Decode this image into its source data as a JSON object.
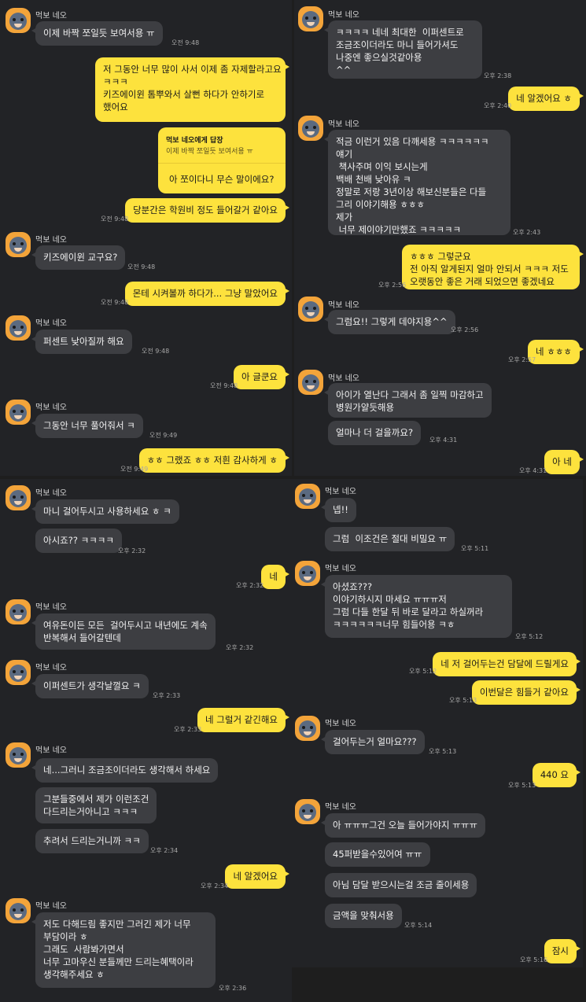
{
  "contact_name": "먹보 네오",
  "panels": {
    "p1": [
      {
        "name": "먹보 네오"
      },
      {
        "text": "이제 바짝 쪼일듯 보여서용 ㅠ",
        "time": "오전 9:48"
      },
      {
        "text": "저 그동안 너무 많이 사서 이제 좀 자제할라고요\nㅋㅋㅋ\n키즈에이윈 톰뿌와서 살뻔 하다가 안하기로\n했어요"
      },
      {
        "reply_title": "먹보 네오에게 답장",
        "reply_quote": "이제 바짝 쪼일듯 보여서용 ㅠ",
        "reply_text": "아 쪼이다니 무슨 말이에요?"
      },
      {
        "text": "당분간은 학원비 정도 들어갈거 같아요",
        "time": "오전 9:48"
      },
      {
        "name": "먹보 네오"
      },
      {
        "text": "키즈에이윈 교구요?",
        "time": "오전 9:48"
      },
      {
        "text": "몬테 시켜볼까 하다가... 그냥 말았어요",
        "time": "오전 9:48"
      },
      {
        "name": "먹보 네오"
      },
      {
        "text": "퍼센트 낮아질까 해요",
        "time": "오전 9:48"
      },
      {
        "text": "아 글쿤요",
        "time": "오전 9:48"
      },
      {
        "name": "먹보 네오"
      },
      {
        "text": "그동안 너무 풀어줘서 ㅋ",
        "time": "오전 9:49"
      },
      {
        "text": "ㅎㅎ 그랬죠 ㅎㅎ 저흰 감사하게 ㅎ",
        "time": "오전 9:49"
      }
    ],
    "p2": [
      {
        "name": "먹보 네오"
      },
      {
        "text": "ㅋㅋㅋㅋ 네네 최대한  이퍼센트로\n조금조이더라도 마니 들어가셔도\n나중엔 좋으실것같아용\n^^",
        "time": "오후 2:38"
      },
      {
        "text": "네 알겠어요 ㅎ",
        "time": "오후 2:40"
      },
      {
        "name": "먹보 네오"
      },
      {
        "text": "적금 이런거 있음 다깨세용 ㅋㅋㅋㅋㅋㅋ\n얘기\n 책사주며 이익 보시는게\n백배 천배 낮아유 ㅋ\n정말로 저랑 3년이상 해보신분들은 다들\n그리 이야기해용 ㅎㅎㅎ\n제가\n 너무 제이야기만했죠 ㅋㅋㅋㅋㅋ",
        "time": "오후 2:43"
      },
      {
        "text": "ㅎㅎㅎ 그렇군요\n전 아직 알게된지 얼마 안되서 ㅋㅋㅋ 저도\n오랫동안 좋은 거래 되었으면 좋겠네요",
        "time": "오후 2:56"
      },
      {
        "name": "먹보 네오"
      },
      {
        "text": "그럼요!! 그렇게 데야지용^^",
        "time": "오후 2:56"
      },
      {
        "text": "네 ㅎㅎㅎ",
        "time": "오후 2:57"
      },
      {
        "name": "먹보 네오"
      },
      {
        "text": "아이가 열난다 그래서 좀 일찍 마감하고\n병원가얄듯해용"
      },
      {
        "text": "얼마나 더 걸을까요?",
        "time": "오후 4:31"
      },
      {
        "text": "아 네",
        "time": "오후 4:31"
      }
    ],
    "p3": [
      {
        "name": "먹보 네오"
      },
      {
        "text": "마니 걸어두시고 사용하세요 ㅎ ㅋ"
      },
      {
        "text": "아시죠?? ㅋㅋㅋㅋ",
        "time": "오후 2:32"
      },
      {
        "text": "네",
        "time": "오후 2:32"
      },
      {
        "name": "먹보 네오"
      },
      {
        "text": "여유돈이든 모든  걸어두시고 내년에도 계속\n반복해서 들어갈텐데",
        "time": "오후 2:32"
      },
      {
        "name": "먹보 네오"
      },
      {
        "text": "이퍼센트가 생각날껄요 ㅋ",
        "time": "오후 2:33"
      },
      {
        "text": "네 그럴거 같긴해요",
        "time": "오후 2:33"
      },
      {
        "name": "먹보 네오"
      },
      {
        "text": "네...그러니 조금조이더라도 생각해서 하세요"
      },
      {
        "text": "그분들중에서 제가 이런조건\n다드리는거아니고 ㅋㅋㅋ"
      },
      {
        "text": "추려서 드리는거니까 ㅋㅋ",
        "time": "오후 2:34"
      },
      {
        "text": "네 알겠어요",
        "time": "오후 2:34"
      },
      {
        "name": "먹보 네오"
      },
      {
        "text": "저도 다해드림 좋지만 그러긴 제가 너무\n부담이라 ㅎ\n그래도  사람봐가면서\n너무 고마우신 분들께만 드리는혜택이라\n생각해주세요 ㅎ",
        "time": "오후 2:36"
      }
    ],
    "p4": [
      {
        "name": "먹보 네오"
      },
      {
        "text": "넵!!"
      },
      {
        "text": "그럼  이조건은 절대 비밀요 ㅠ",
        "time": "오후 5:11"
      },
      {
        "name": "먹보 네오"
      },
      {
        "text": "아셨죠???\n이야기하시지 마세요 ㅠㅠㅠ저\n그럼 다들 한달 뒤 바로 달라고 하실꺼라\nㅋㅋㅋㅋㅋㅋ너무 힘들어용 ㅋㅎ",
        "time": "오후 5:12"
      },
      {
        "text": "네 저 걸어두는건 담달에 드릴게요",
        "time": "오후 5:12"
      },
      {
        "text": "이번달은 힘들거 같아요",
        "time": "오후 5:13"
      },
      {
        "name": "먹보 네오"
      },
      {
        "text": "걸어두는거 얼마요???",
        "time": "오후 5:13"
      },
      {
        "text": "440 요",
        "time": "오후 5:13"
      },
      {
        "name": "먹보 네오"
      },
      {
        "text": "아 ㅠㅠㅠ그건 오늘 들어가야지 ㅠㅠㅠ"
      },
      {
        "text": "45퍼받을수있어여 ㅠㅠ"
      },
      {
        "text": "아님 담달 받으시는걸 조금 줄이세용"
      },
      {
        "text": "금액을 맞춰서용",
        "time": "오후 5:14"
      },
      {
        "text": "잠시",
        "time": "오후 5:16"
      }
    ]
  }
}
